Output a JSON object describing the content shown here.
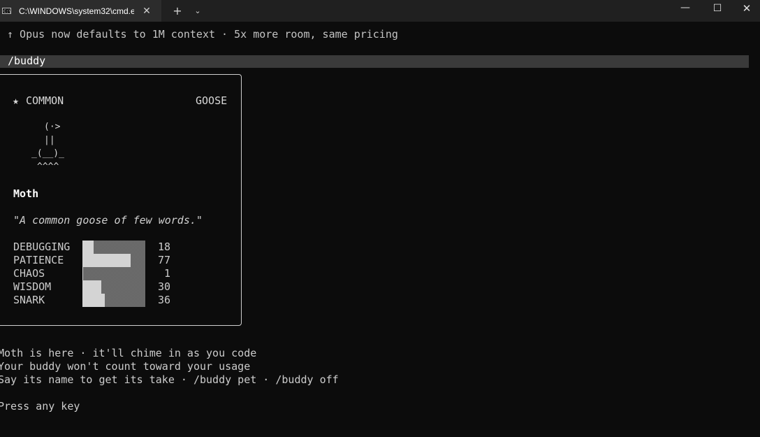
{
  "window": {
    "tab_title": "C:\\WINDOWS\\system32\\cmd.e",
    "tab_icon_text": "C:\\",
    "close_tab_glyph": "✕",
    "new_tab_glyph": "+",
    "dropdown_glyph": "⌄",
    "minimize_glyph": "—",
    "maximize_glyph": "☐",
    "close_glyph": "✕"
  },
  "notice": "↑ Opus now defaults to 1M context · 5x more room, same pricing",
  "command": "/buddy",
  "card": {
    "rarity_star": "★",
    "rarity": "COMMON",
    "species": "GOOSE",
    "art": [
      " (·>",
      " ||",
      "_(__)_",
      " ^^^^"
    ],
    "name": "Moth",
    "quote": "\"A common goose of few words.\"",
    "stats": [
      {
        "label": "DEBUGGING",
        "value": 18
      },
      {
        "label": "PATIENCE",
        "value": 77
      },
      {
        "label": "CHAOS",
        "value": 1
      },
      {
        "label": "WISDOM",
        "value": 30
      },
      {
        "label": "SNARK",
        "value": 36
      }
    ],
    "stat_max": 100
  },
  "messages": [
    "Moth is here · it'll chime in as you code",
    "Your buddy won't count toward your usage",
    "Say its name to get its take · /buddy pet · /buddy off"
  ],
  "prompt": "Press any key",
  "colors": {
    "background": "#0c0c0c",
    "titlebar": "#202020",
    "active_tab": "#2c2c2c",
    "command_highlight": "#3a3a3a",
    "bar_fill": "#d4d4d4"
  }
}
